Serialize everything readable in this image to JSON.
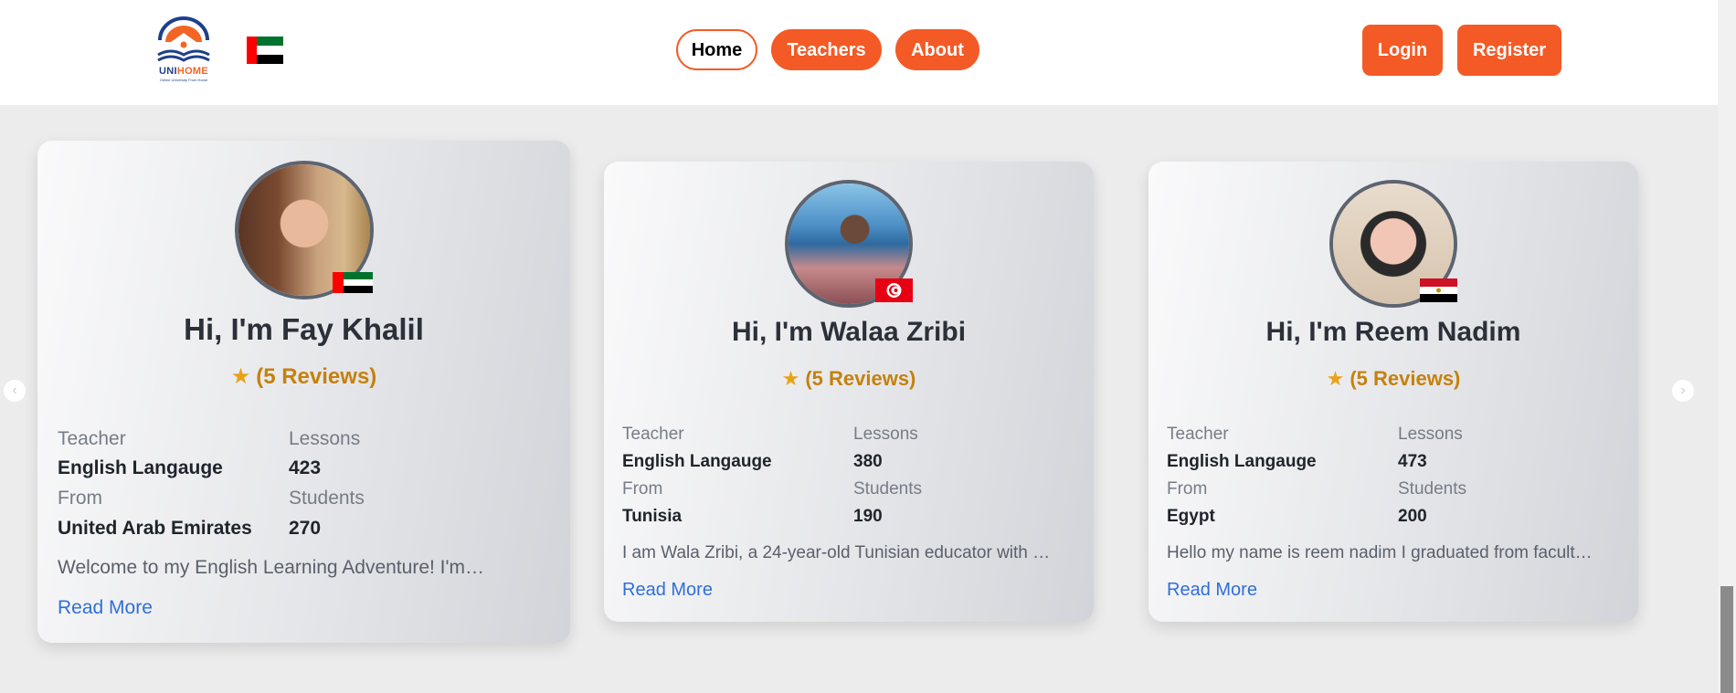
{
  "header": {
    "logo_text_1": "UNI",
    "logo_text_2": "HOME",
    "logo_tagline": "Online University From Home",
    "nav": {
      "home": "Home",
      "teachers": "Teachers",
      "about": "About"
    },
    "login": "Login",
    "register": "Register"
  },
  "carousel": {
    "prev_icon": "‹",
    "next_icon": "›"
  },
  "labels": {
    "teacher": "Teacher",
    "lessons": "Lessons",
    "from": "From",
    "students": "Students",
    "read_more": "Read More"
  },
  "teachers": [
    {
      "name": "Hi, I'm Fay Khalil",
      "reviews": "(5 Reviews)",
      "subject": "English Langauge",
      "lessons": "423",
      "country": "United Arab Emirates",
      "students": "270",
      "description": "Welcome to my English Learning Adventure! I'm…",
      "flag": "uae-flag"
    },
    {
      "name": "Hi, I'm Walaa Zribi",
      "reviews": "(5 Reviews)",
      "subject": "English Langauge",
      "lessons": "380",
      "country": "Tunisia",
      "students": "190",
      "description": "I am Wala Zribi, a 24-year-old Tunisian educator with …",
      "flag": "tunisia-flag"
    },
    {
      "name": "Hi, I'm Reem Nadim",
      "reviews": "(5 Reviews)",
      "subject": "English Langauge",
      "lessons": "473",
      "country": "Egypt",
      "students": "200",
      "description": "Hello my name is reem nadim I graduated from facult…",
      "flag": "egypt-flag"
    }
  ],
  "colors": {
    "accent": "#f45a26",
    "link": "#2f6fd8",
    "rating": "#c5810d"
  }
}
